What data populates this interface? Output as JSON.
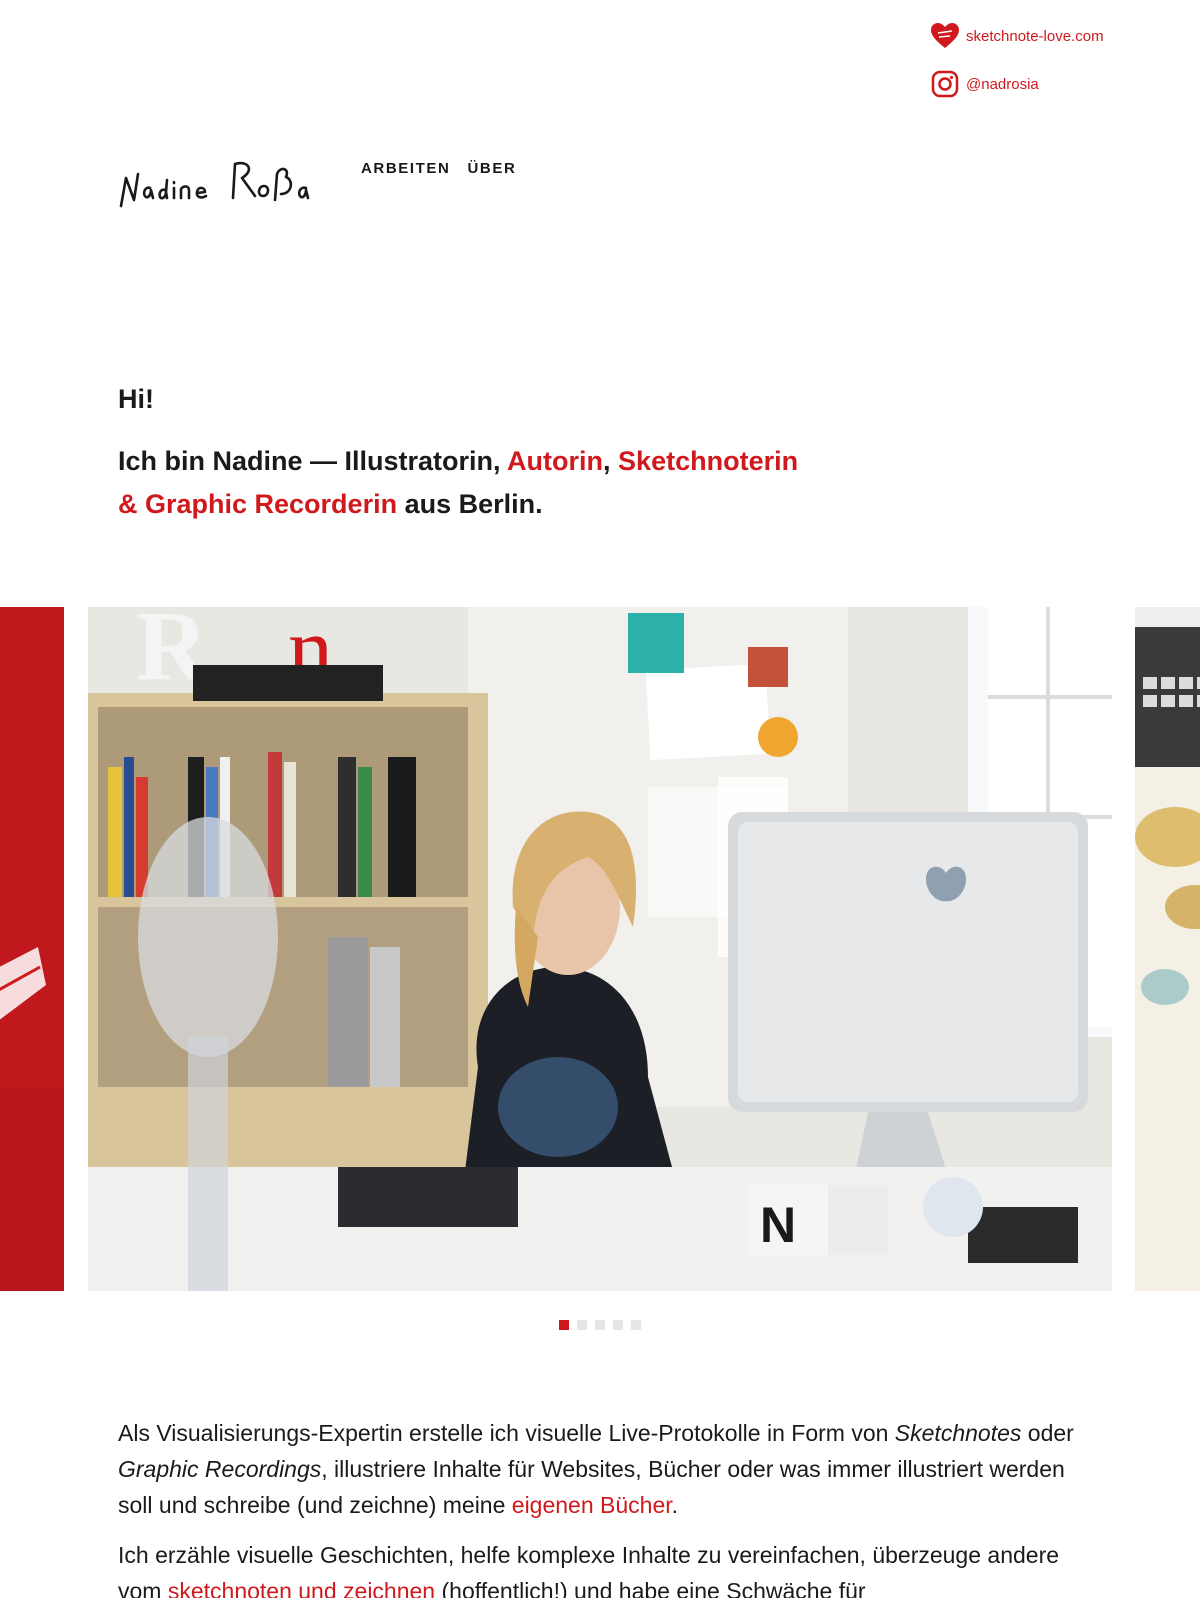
{
  "social": {
    "site_label": "sketchnote-love.com",
    "site_icon": "heart-logo-icon",
    "instagram_label": "@nadrosia",
    "instagram_icon": "instagram-icon"
  },
  "header": {
    "logo_text": "Nadine Roßa",
    "nav": [
      {
        "label": "ARBEITEN"
      },
      {
        "label": "ÜBER"
      }
    ]
  },
  "intro": {
    "greeting": "Hi!",
    "line_part1": "Ich bin Nadine — Illustratorin, ",
    "link_autorin": "Autorin",
    "comma": ", ",
    "link_sketchnoterin": "Sketchnoterin",
    "link_graphic": "& Graphic Recorderin",
    "line_part2": " aus Berlin."
  },
  "carousel": {
    "slide_count": 5,
    "active_index": 0
  },
  "body": {
    "p1_a": "Als Visualisierungs-Expertin erstelle ich visuelle Live-Protokolle in Form von ",
    "p1_em1": "Sketchnotes",
    "p1_b": " oder ",
    "p1_em2": "Graphic Recordings",
    "p1_c": ", illustriere Inhalte für Websites, Bücher oder was immer illustriert werden soll und schreibe (und zeichne) meine ",
    "p1_link": "eigenen Bücher",
    "p1_d": ".",
    "p2_a": "Ich erzähle visuelle Geschichten, helfe komplexe Inhalte zu vereinfachen, überzeuge andere vom ",
    "p2_link": "sketchnoten und zeichnen",
    "p2_b": " (hoffentlich!) und habe eine Schwäche für"
  },
  "colors": {
    "accent": "#d0191c",
    "text": "#1a1a1a"
  }
}
